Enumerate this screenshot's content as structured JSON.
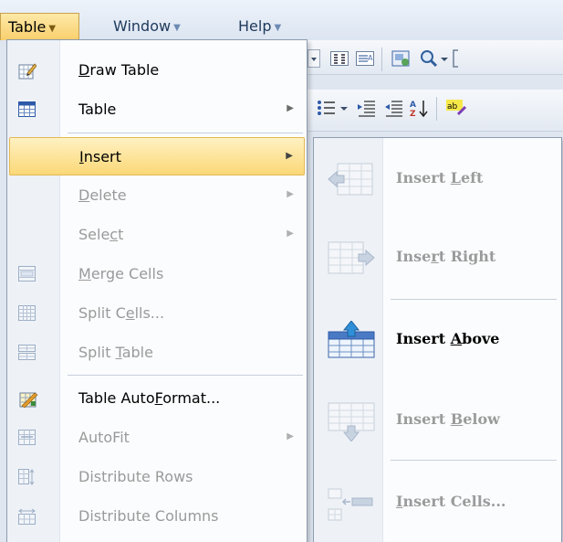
{
  "menubar": {
    "table": "Table",
    "window": "Window",
    "help": "Help",
    "arrow": "▼"
  },
  "table_menu": {
    "items": [
      {
        "key": "draw_table",
        "pre": "",
        "u": "D",
        "post": "raw Table",
        "icon": "draw-table-icon",
        "enabled": true,
        "submenu": false
      },
      {
        "key": "table",
        "pre": "Table",
        "u": "",
        "post": "",
        "icon": "table-grid-icon",
        "enabled": true,
        "submenu": true
      },
      {
        "key": "insert",
        "pre": "",
        "u": "I",
        "post": "nsert",
        "icon": "",
        "enabled": true,
        "submenu": true,
        "highlighted": true
      },
      {
        "key": "delete",
        "pre": "",
        "u": "D",
        "post": "elete",
        "icon": "",
        "enabled": false,
        "submenu": true
      },
      {
        "key": "select",
        "pre": "Sele",
        "u": "c",
        "post": "t",
        "icon": "",
        "enabled": false,
        "submenu": true
      },
      {
        "key": "merge_cells",
        "pre": "",
        "u": "M",
        "post": "erge Cells",
        "icon": "merge-cells-icon",
        "enabled": false,
        "submenu": false
      },
      {
        "key": "split_cells",
        "pre": "Split C",
        "u": "e",
        "post": "lls...",
        "icon": "split-cells-icon",
        "enabled": false,
        "submenu": false
      },
      {
        "key": "split_table",
        "pre": "Split ",
        "u": "T",
        "post": "able",
        "icon": "split-table-icon",
        "enabled": false,
        "submenu": false
      },
      {
        "key": "table_autoformat",
        "pre": "Table Auto",
        "u": "F",
        "post": "ormat...",
        "icon": "table-autoformat-icon",
        "enabled": true,
        "submenu": false
      },
      {
        "key": "autofit",
        "pre": "AutoFit",
        "u": "",
        "post": "",
        "icon": "autofit-icon",
        "enabled": false,
        "submenu": true
      },
      {
        "key": "distribute_rows",
        "pre": "Distribute Rows",
        "u": "",
        "post": "",
        "icon": "distribute-rows-icon",
        "enabled": false,
        "submenu": false
      },
      {
        "key": "distribute_columns",
        "pre": "Distribute Columns",
        "u": "",
        "post": "",
        "icon": "distribute-columns-icon",
        "enabled": false,
        "submenu": false
      }
    ],
    "submenu_arrow": "▶"
  },
  "insert_submenu": {
    "items": [
      {
        "key": "insert_left",
        "pre": "Insert ",
        "u": "L",
        "post": "eft",
        "icon": "insert-left-icon",
        "enabled": false
      },
      {
        "key": "insert_right",
        "pre": "Inse",
        "u": "r",
        "post": "t Right",
        "icon": "insert-right-icon",
        "enabled": false
      },
      {
        "key": "insert_above",
        "pre": "Insert ",
        "u": "A",
        "post": "bove",
        "icon": "insert-above-icon",
        "enabled": true
      },
      {
        "key": "insert_below",
        "pre": "Insert ",
        "u": "B",
        "post": "elow",
        "icon": "insert-below-icon",
        "enabled": false
      },
      {
        "key": "insert_cells",
        "pre": "",
        "u": "I",
        "post": "nsert Cells...",
        "icon": "insert-cells-icon",
        "enabled": false
      }
    ]
  },
  "colors": {
    "highlight_top": "#fff1c2",
    "highlight_bottom": "#fbd877",
    "disabled_text": "#9a9a9a",
    "menubar_text": "#1e395b"
  }
}
